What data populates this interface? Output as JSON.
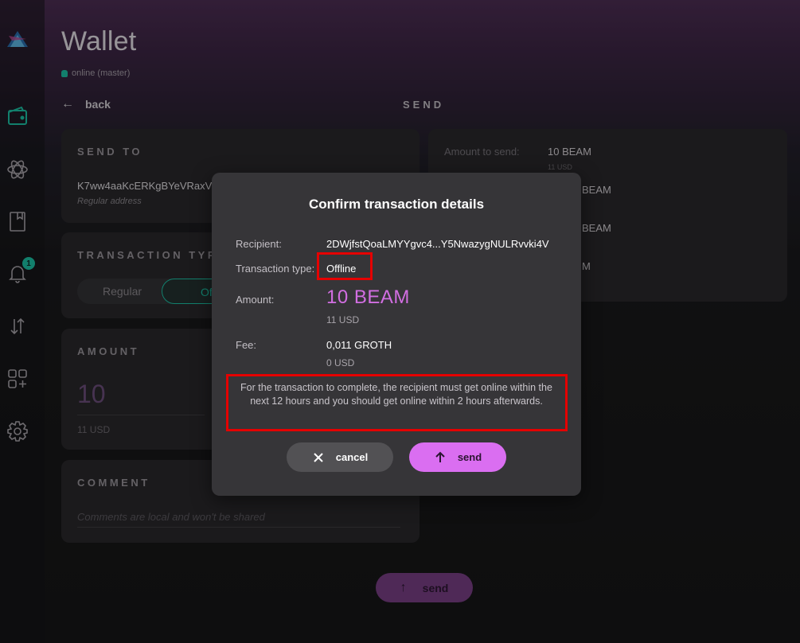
{
  "window": {
    "title": "Wallet",
    "status": "online (master)"
  },
  "nav": {
    "back_label": "back",
    "page_heading": "SEND",
    "notifications_badge": "1"
  },
  "send_to": {
    "label": "SEND TO",
    "address": "K7ww4aaKcERKgBYeVRaxVh",
    "address_type": "Regular address"
  },
  "transaction_type": {
    "label": "TRANSACTION TYPE",
    "options": [
      "Regular",
      "Offline"
    ],
    "selected": "Offline"
  },
  "amount": {
    "label": "AMOUNT",
    "value": "10",
    "usd": "11 USD"
  },
  "comment": {
    "label": "COMMENT",
    "placeholder": "Comments are local and won't be shared"
  },
  "summary": {
    "amount_label": "Amount to send:",
    "amount_value": "10  BEAM",
    "amount_usd": "11 USD",
    "row2_value": "BEAM",
    "row3_value": "BEAM",
    "row4_value": "M"
  },
  "bottom": {
    "send_label": "send"
  },
  "dialog": {
    "title": "Confirm transaction details",
    "recipient_label": "Recipient:",
    "recipient_value": "2DWjfstQoaLMYYgvc4...Y5NwazygNULRvvki4V",
    "type_label": "Transaction type:",
    "type_value": "Offline",
    "amount_label": "Amount:",
    "amount_value": "10  BEAM",
    "amount_usd": "11 USD",
    "fee_label": "Fee:",
    "fee_value": "0,011 GROTH",
    "fee_usd": "0 USD",
    "note": "For the transaction to complete, the recipient must get online within the next 12 hours and you should get online within 2 hours afterwards.",
    "cancel_label": "cancel",
    "send_label": "send"
  },
  "colors": {
    "accent_teal": "#1cc3a7",
    "accent_purple": "#da6ef1",
    "highlight_red": "#e50000"
  }
}
